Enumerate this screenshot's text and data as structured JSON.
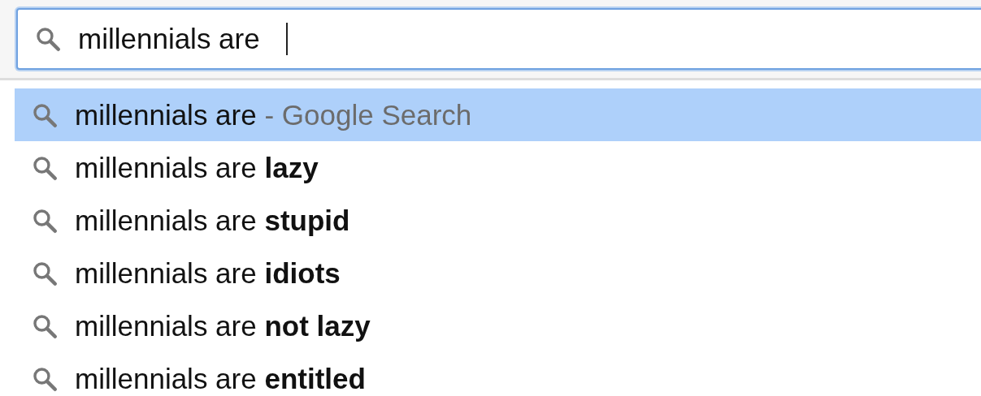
{
  "search_field": {
    "value": "millennials are"
  },
  "suggestions": [
    {
      "text": "millennials are",
      "hint": "- Google Search",
      "selected": true
    },
    {
      "text": "millennials are **lazy**",
      "selected": false
    },
    {
      "text": "millennials are **stupid**",
      "selected": false
    },
    {
      "text": "millennials are **idiots**",
      "selected": false
    },
    {
      "text": "millennials are **not lazy**",
      "selected": false
    },
    {
      "text": "millennials are **entitled**",
      "selected": false
    }
  ]
}
